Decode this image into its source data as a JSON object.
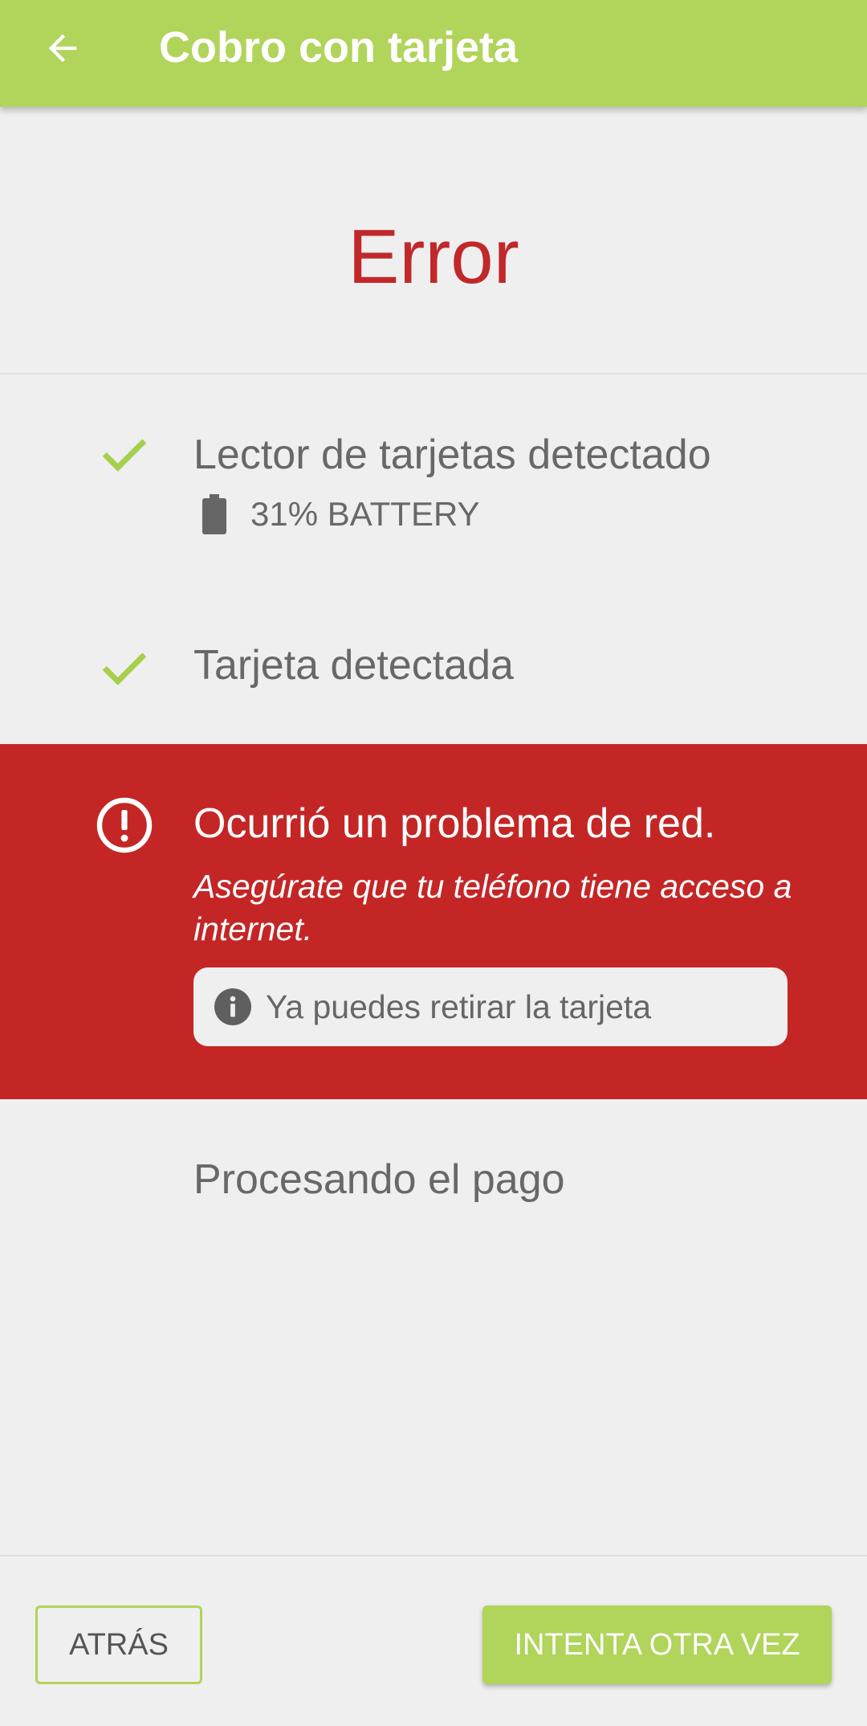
{
  "colors": {
    "accent": "#b1d45b",
    "error": "#c42626",
    "error_text": "#c0282a",
    "background": "#efefef",
    "text_secondary": "#686868"
  },
  "header": {
    "title": "Cobro con tarjeta",
    "back_icon": "arrow-back-icon"
  },
  "status": {
    "title": "Error"
  },
  "steps": [
    {
      "label": "Lector de tarjetas detectado",
      "icon": "check-icon",
      "state": "done",
      "detail": {
        "icon": "battery-icon",
        "text": "31% BATTERY"
      }
    },
    {
      "label": "Tarjeta detectada",
      "icon": "check-icon",
      "state": "done"
    },
    {
      "label": "Ocurrió un problema de red.",
      "icon": "alert-circle-icon",
      "state": "error",
      "description": "Asegúrate que tu teléfono tiene acceso a internet.",
      "notice": {
        "icon": "info-icon",
        "text": "Ya puedes retirar la tarjeta"
      }
    },
    {
      "label": "Procesando el pago",
      "state": "pending"
    }
  ],
  "footer": {
    "back_label": "ATRÁS",
    "retry_label": "INTENTA OTRA VEZ"
  }
}
